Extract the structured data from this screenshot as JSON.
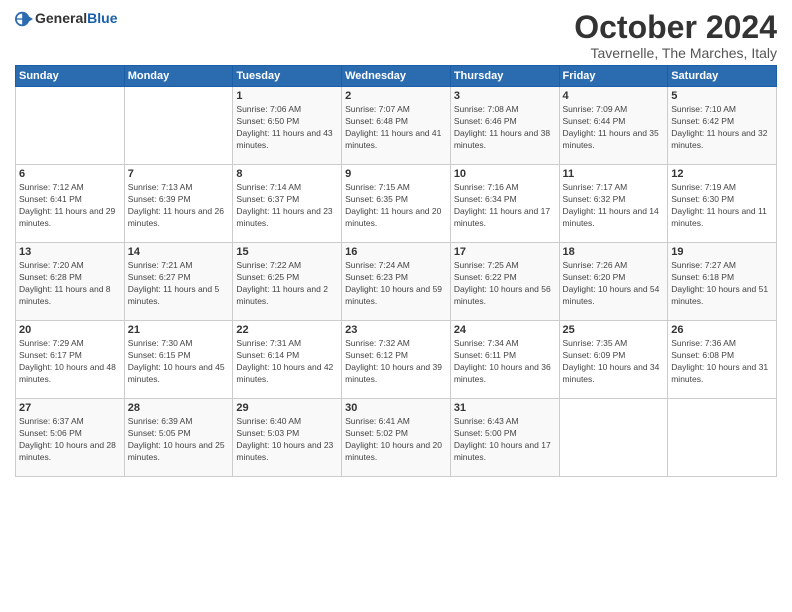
{
  "header": {
    "logo_general": "General",
    "logo_blue": "Blue",
    "month_title": "October 2024",
    "subtitle": "Tavernelle, The Marches, Italy"
  },
  "days_of_week": [
    "Sunday",
    "Monday",
    "Tuesday",
    "Wednesday",
    "Thursday",
    "Friday",
    "Saturday"
  ],
  "weeks": [
    [
      {
        "day": "",
        "sunrise": "",
        "sunset": "",
        "daylight": ""
      },
      {
        "day": "",
        "sunrise": "",
        "sunset": "",
        "daylight": ""
      },
      {
        "day": "1",
        "sunrise": "Sunrise: 7:06 AM",
        "sunset": "Sunset: 6:50 PM",
        "daylight": "Daylight: 11 hours and 43 minutes."
      },
      {
        "day": "2",
        "sunrise": "Sunrise: 7:07 AM",
        "sunset": "Sunset: 6:48 PM",
        "daylight": "Daylight: 11 hours and 41 minutes."
      },
      {
        "day": "3",
        "sunrise": "Sunrise: 7:08 AM",
        "sunset": "Sunset: 6:46 PM",
        "daylight": "Daylight: 11 hours and 38 minutes."
      },
      {
        "day": "4",
        "sunrise": "Sunrise: 7:09 AM",
        "sunset": "Sunset: 6:44 PM",
        "daylight": "Daylight: 11 hours and 35 minutes."
      },
      {
        "day": "5",
        "sunrise": "Sunrise: 7:10 AM",
        "sunset": "Sunset: 6:42 PM",
        "daylight": "Daylight: 11 hours and 32 minutes."
      }
    ],
    [
      {
        "day": "6",
        "sunrise": "Sunrise: 7:12 AM",
        "sunset": "Sunset: 6:41 PM",
        "daylight": "Daylight: 11 hours and 29 minutes."
      },
      {
        "day": "7",
        "sunrise": "Sunrise: 7:13 AM",
        "sunset": "Sunset: 6:39 PM",
        "daylight": "Daylight: 11 hours and 26 minutes."
      },
      {
        "day": "8",
        "sunrise": "Sunrise: 7:14 AM",
        "sunset": "Sunset: 6:37 PM",
        "daylight": "Daylight: 11 hours and 23 minutes."
      },
      {
        "day": "9",
        "sunrise": "Sunrise: 7:15 AM",
        "sunset": "Sunset: 6:35 PM",
        "daylight": "Daylight: 11 hours and 20 minutes."
      },
      {
        "day": "10",
        "sunrise": "Sunrise: 7:16 AM",
        "sunset": "Sunset: 6:34 PM",
        "daylight": "Daylight: 11 hours and 17 minutes."
      },
      {
        "day": "11",
        "sunrise": "Sunrise: 7:17 AM",
        "sunset": "Sunset: 6:32 PM",
        "daylight": "Daylight: 11 hours and 14 minutes."
      },
      {
        "day": "12",
        "sunrise": "Sunrise: 7:19 AM",
        "sunset": "Sunset: 6:30 PM",
        "daylight": "Daylight: 11 hours and 11 minutes."
      }
    ],
    [
      {
        "day": "13",
        "sunrise": "Sunrise: 7:20 AM",
        "sunset": "Sunset: 6:28 PM",
        "daylight": "Daylight: 11 hours and 8 minutes."
      },
      {
        "day": "14",
        "sunrise": "Sunrise: 7:21 AM",
        "sunset": "Sunset: 6:27 PM",
        "daylight": "Daylight: 11 hours and 5 minutes."
      },
      {
        "day": "15",
        "sunrise": "Sunrise: 7:22 AM",
        "sunset": "Sunset: 6:25 PM",
        "daylight": "Daylight: 11 hours and 2 minutes."
      },
      {
        "day": "16",
        "sunrise": "Sunrise: 7:24 AM",
        "sunset": "Sunset: 6:23 PM",
        "daylight": "Daylight: 10 hours and 59 minutes."
      },
      {
        "day": "17",
        "sunrise": "Sunrise: 7:25 AM",
        "sunset": "Sunset: 6:22 PM",
        "daylight": "Daylight: 10 hours and 56 minutes."
      },
      {
        "day": "18",
        "sunrise": "Sunrise: 7:26 AM",
        "sunset": "Sunset: 6:20 PM",
        "daylight": "Daylight: 10 hours and 54 minutes."
      },
      {
        "day": "19",
        "sunrise": "Sunrise: 7:27 AM",
        "sunset": "Sunset: 6:18 PM",
        "daylight": "Daylight: 10 hours and 51 minutes."
      }
    ],
    [
      {
        "day": "20",
        "sunrise": "Sunrise: 7:29 AM",
        "sunset": "Sunset: 6:17 PM",
        "daylight": "Daylight: 10 hours and 48 minutes."
      },
      {
        "day": "21",
        "sunrise": "Sunrise: 7:30 AM",
        "sunset": "Sunset: 6:15 PM",
        "daylight": "Daylight: 10 hours and 45 minutes."
      },
      {
        "day": "22",
        "sunrise": "Sunrise: 7:31 AM",
        "sunset": "Sunset: 6:14 PM",
        "daylight": "Daylight: 10 hours and 42 minutes."
      },
      {
        "day": "23",
        "sunrise": "Sunrise: 7:32 AM",
        "sunset": "Sunset: 6:12 PM",
        "daylight": "Daylight: 10 hours and 39 minutes."
      },
      {
        "day": "24",
        "sunrise": "Sunrise: 7:34 AM",
        "sunset": "Sunset: 6:11 PM",
        "daylight": "Daylight: 10 hours and 36 minutes."
      },
      {
        "day": "25",
        "sunrise": "Sunrise: 7:35 AM",
        "sunset": "Sunset: 6:09 PM",
        "daylight": "Daylight: 10 hours and 34 minutes."
      },
      {
        "day": "26",
        "sunrise": "Sunrise: 7:36 AM",
        "sunset": "Sunset: 6:08 PM",
        "daylight": "Daylight: 10 hours and 31 minutes."
      }
    ],
    [
      {
        "day": "27",
        "sunrise": "Sunrise: 6:37 AM",
        "sunset": "Sunset: 5:06 PM",
        "daylight": "Daylight: 10 hours and 28 minutes."
      },
      {
        "day": "28",
        "sunrise": "Sunrise: 6:39 AM",
        "sunset": "Sunset: 5:05 PM",
        "daylight": "Daylight: 10 hours and 25 minutes."
      },
      {
        "day": "29",
        "sunrise": "Sunrise: 6:40 AM",
        "sunset": "Sunset: 5:03 PM",
        "daylight": "Daylight: 10 hours and 23 minutes."
      },
      {
        "day": "30",
        "sunrise": "Sunrise: 6:41 AM",
        "sunset": "Sunset: 5:02 PM",
        "daylight": "Daylight: 10 hours and 20 minutes."
      },
      {
        "day": "31",
        "sunrise": "Sunrise: 6:43 AM",
        "sunset": "Sunset: 5:00 PM",
        "daylight": "Daylight: 10 hours and 17 minutes."
      },
      {
        "day": "",
        "sunrise": "",
        "sunset": "",
        "daylight": ""
      },
      {
        "day": "",
        "sunrise": "",
        "sunset": "",
        "daylight": ""
      }
    ]
  ]
}
